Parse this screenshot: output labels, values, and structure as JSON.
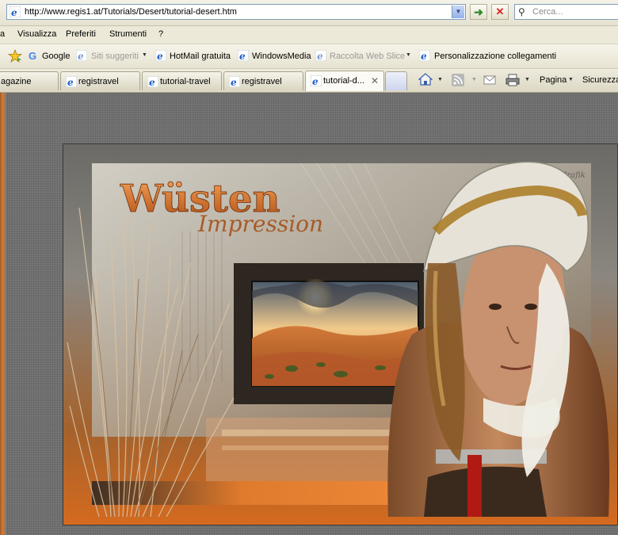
{
  "address_bar": {
    "url": "http://www.regis1.at/Tutorials/Desert/tutorial-desert.htm",
    "search_placeholder": "Cerca..."
  },
  "menu": [
    "a",
    "Visualizza",
    "Preferiti",
    "Strumenti",
    "?"
  ],
  "links_bar": {
    "google": "Google",
    "siti_suggeriti": "Siti suggeriti",
    "hotmail": "HotMail gratuita",
    "windowsmedia": "WindowsMedia",
    "raccolta": "Raccolta Web Slice",
    "personalizzazione": "Personalizzazione collegamenti"
  },
  "tabs": [
    {
      "label": "agazine"
    },
    {
      "label": "registravel"
    },
    {
      "label": "tutorial-travel"
    },
    {
      "label": "registravel"
    },
    {
      "label": "tutorial-d..."
    }
  ],
  "command_bar": {
    "pagina": "Pagina",
    "sicurezza": "Sicurezza"
  },
  "artwork": {
    "title": "Wüsten",
    "subtitle": "Impression",
    "watermark": "Regis Grafik"
  },
  "colors": {
    "ie_blue": "#1f5fc9",
    "accent_orange": "#e07a2c",
    "content_grey": "#6f6f6f"
  }
}
